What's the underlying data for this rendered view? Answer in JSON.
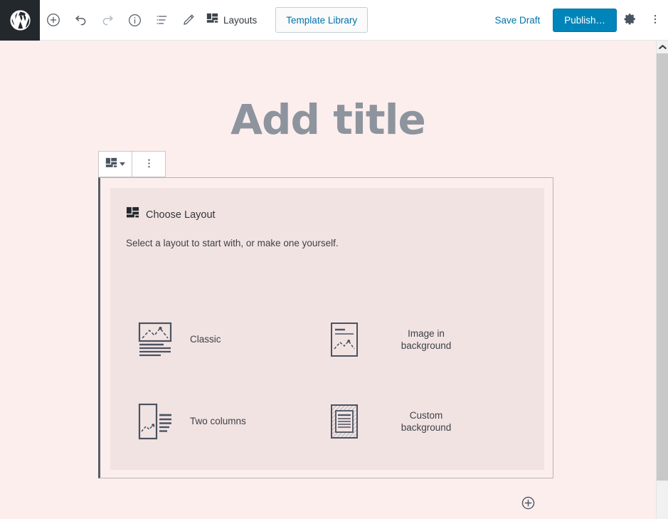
{
  "toolbar": {
    "logo_name": "wordpress-logo",
    "left_buttons": [
      {
        "name": "add-block-button",
        "icon": "plus-circle-icon",
        "label": "Add block",
        "disabled": false
      },
      {
        "name": "undo-button",
        "icon": "undo-icon",
        "label": "Undo",
        "disabled": false
      },
      {
        "name": "redo-button",
        "icon": "redo-icon",
        "label": "Redo",
        "disabled": true
      },
      {
        "name": "content-info-button",
        "icon": "info-circle-icon",
        "label": "Content structure",
        "disabled": false
      },
      {
        "name": "block-navigation-button",
        "icon": "list-view-icon",
        "label": "Block navigation",
        "disabled": false
      },
      {
        "name": "edit-mode-button",
        "icon": "pencil-icon",
        "label": "Edit",
        "disabled": false
      }
    ],
    "layouts_label": "Layouts",
    "template_library_label": "Template Library",
    "save_draft_label": "Save Draft",
    "publish_label": "Publish…",
    "settings_label": "Settings",
    "more_label": "More tools & options",
    "accent_color": "#0085ba",
    "link_color": "#0073aa",
    "logo_bg": "#23282d"
  },
  "canvas": {
    "background_color": "#fdeeee",
    "title_placeholder": "Add title",
    "title_color": "#8d949e"
  },
  "block_toolbar": {
    "layout_picker_label": "Change layout",
    "more_options_label": "More options"
  },
  "block": {
    "panel_background": "#f2e3e3",
    "selected_border_color": "#555d66",
    "heading": "Choose Layout",
    "heading_icon": "layouts-icon",
    "subtitle": "Select a layout to start with, or make one yourself.",
    "options": [
      {
        "label": "Classic",
        "icon": "classic-layout-icon",
        "name": "layout-option-classic"
      },
      {
        "label": "Image in background",
        "icon": "image-in-background-layout-icon",
        "name": "layout-option-image-in-background"
      },
      {
        "label": "Two columns",
        "icon": "two-columns-layout-icon",
        "name": "layout-option-two-columns"
      },
      {
        "label": "Custom background",
        "icon": "custom-background-layout-icon",
        "name": "layout-option-custom-background"
      }
    ],
    "appender_label": "Add block"
  },
  "scrollbar": {
    "up_arrow_label": "Scroll up",
    "track_color": "#f1f1f1",
    "thumb_color": "#c8c8c8"
  }
}
